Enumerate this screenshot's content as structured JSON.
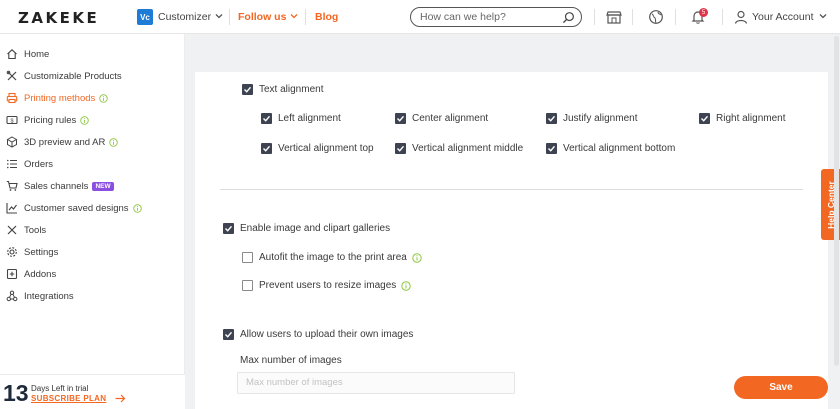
{
  "header": {
    "logo": "ZAKEKE",
    "app_badge": "Vc",
    "customizer_label": "Customizer",
    "follow_label": "Follow us",
    "blog_label": "Blog",
    "search_placeholder": "How can we help?",
    "notification_count": "5",
    "account_label": "Your Account"
  },
  "sidebar": {
    "items": [
      {
        "label": "Home"
      },
      {
        "label": "Customizable Products"
      },
      {
        "label": "Printing methods"
      },
      {
        "label": "Pricing rules"
      },
      {
        "label": "3D preview and AR"
      },
      {
        "label": "Orders"
      },
      {
        "label": "Sales channels",
        "badge": "NEW"
      },
      {
        "label": "Customer saved designs"
      },
      {
        "label": "Tools"
      },
      {
        "label": "Settings"
      },
      {
        "label": "Addons"
      },
      {
        "label": "Integrations"
      }
    ],
    "trial": {
      "days": "13",
      "days_label": "Days Left in trial",
      "plan_link": "SUBSCRIBE PLAN"
    }
  },
  "main": {
    "text_alignment": {
      "label": "Text alignment",
      "checked": true
    },
    "alignments": [
      {
        "label": "Left alignment",
        "checked": true
      },
      {
        "label": "Center alignment",
        "checked": true
      },
      {
        "label": "Justify alignment",
        "checked": true
      },
      {
        "label": "Right alignment",
        "checked": true
      },
      {
        "label": "Vertical alignment top",
        "checked": true
      },
      {
        "label": "Vertical alignment middle",
        "checked": true
      },
      {
        "label": "Vertical alignment bottom",
        "checked": true
      }
    ],
    "image_galleries": {
      "label": "Enable image and clipart galleries",
      "checked": true
    },
    "autofit": {
      "label": "Autofit the image to the print area",
      "checked": false
    },
    "prevent_resize": {
      "label": "Prevent users to resize images",
      "checked": false
    },
    "upload_images": {
      "label": "Allow users to upload their own images",
      "checked": true
    },
    "max_images_label": "Max number of images",
    "max_images_placeholder": "Max number of images"
  },
  "actions": {
    "save_label": "Save",
    "help_center_label": "Help Center"
  },
  "colors": {
    "accent": "#f26722",
    "checkbox": "#3d4350",
    "info_icon": "#8cc63f",
    "new_badge": "#8a4fe0"
  }
}
